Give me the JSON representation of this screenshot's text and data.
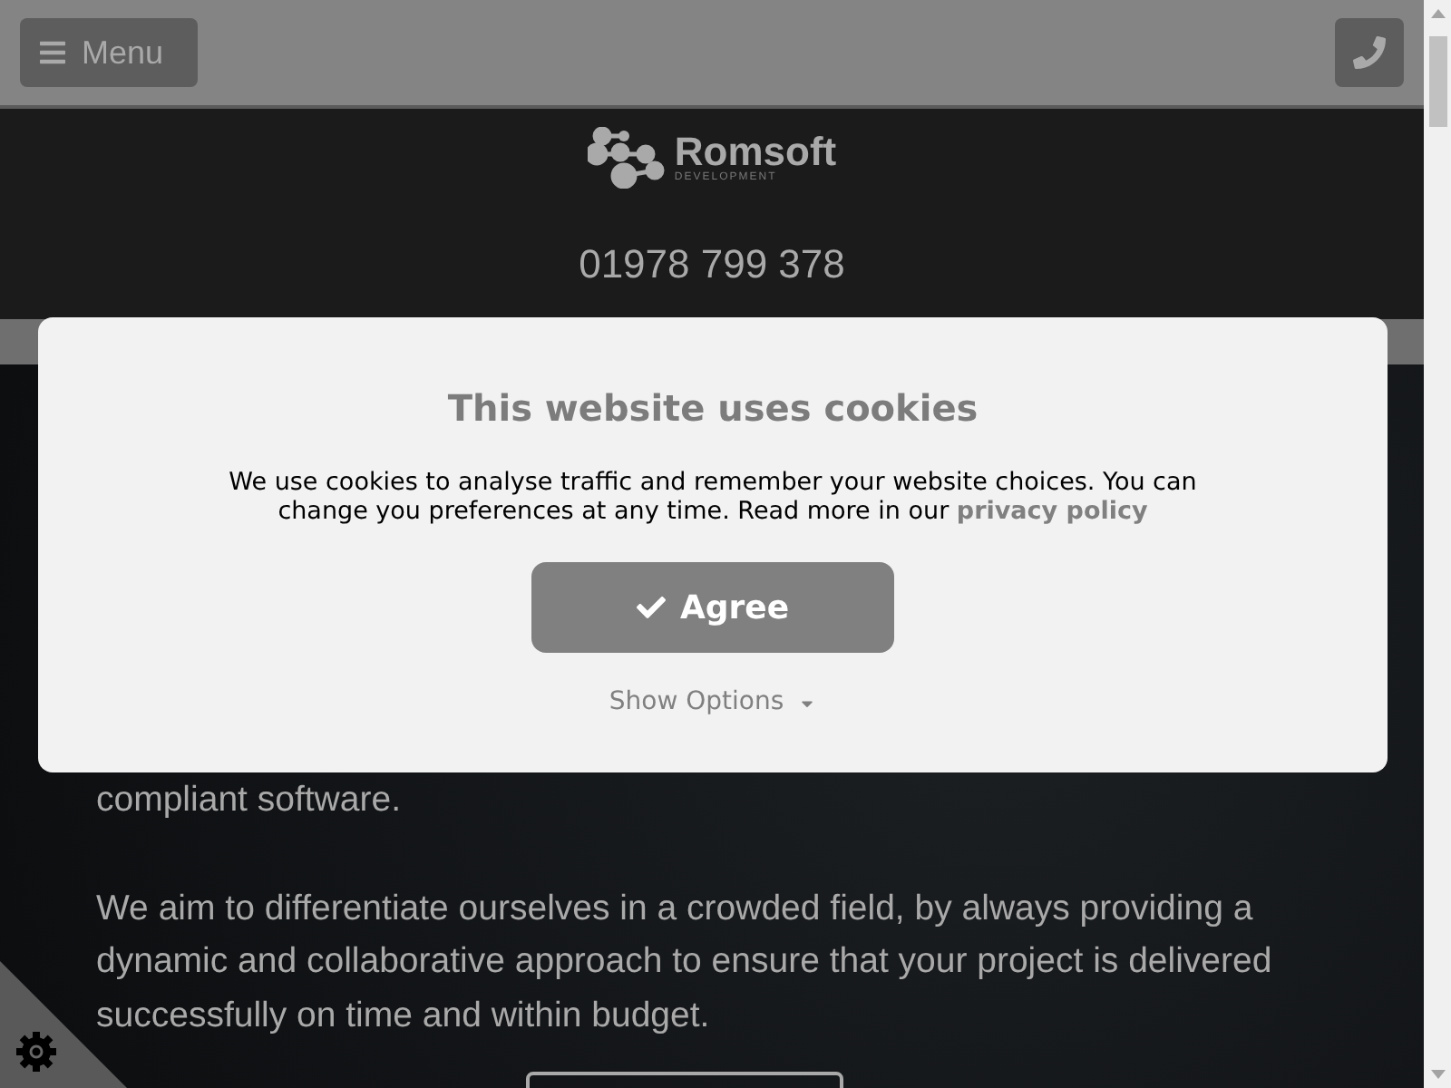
{
  "top_bar": {
    "menu_button": {
      "label": "Menu"
    }
  },
  "header": {
    "logo_name": "Romsoft",
    "logo_tagline": "DEVELOPMENT",
    "phone": "01978 799 378"
  },
  "hero": {
    "paragraphs": [
      "compliant software.",
      "We aim to differentiate ourselves in a crowded field, by always providing a dynamic and collaborative approach to ensure that your project is delivered successfully on time and within budget."
    ]
  },
  "cookie_dialog": {
    "title": "This website uses cookies",
    "text": "We use cookies to analyse traffic and remember your website choices. You can change you preferences at any time. Read more in our",
    "link": "privacy policy",
    "agree_button": "Agree",
    "options_toggle": {
      "label": "Show Options",
      "expanded": false
    }
  }
}
